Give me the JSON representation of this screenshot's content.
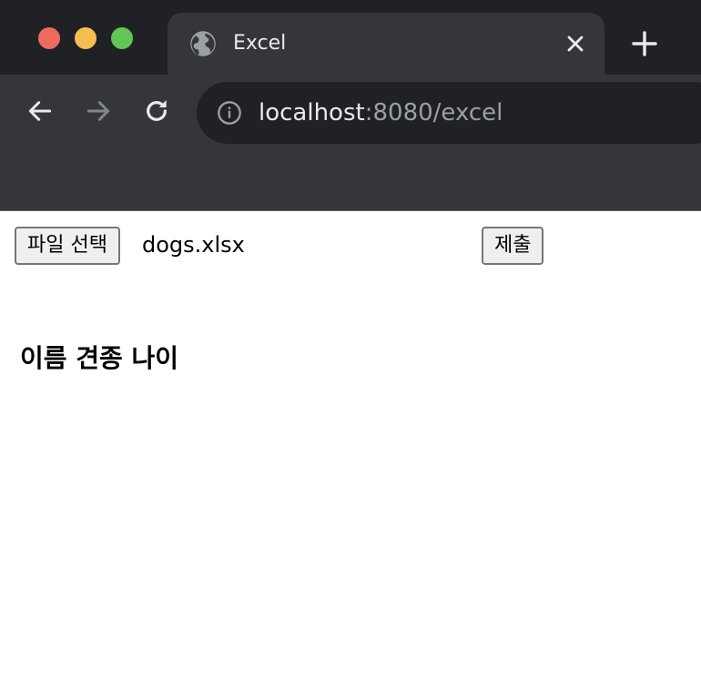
{
  "browser": {
    "tab": {
      "title": "Excel",
      "favicon": "globe-icon"
    },
    "address": {
      "host": "localhost",
      "rest": ":8080/excel"
    },
    "colors": {
      "chrome_dark": "#202124",
      "chrome": "#35363a",
      "text": "#e8eaed",
      "muted": "#9aa0a6"
    }
  },
  "form": {
    "file_button_label": "파일 선택",
    "file_name": "dogs.xlsx",
    "submit_label": "제출"
  },
  "table": {
    "header": "이름 견종 나이"
  }
}
